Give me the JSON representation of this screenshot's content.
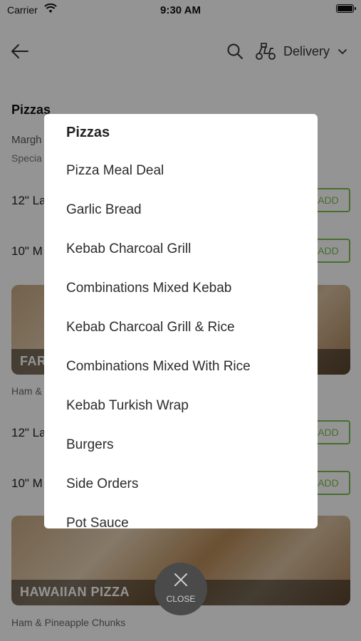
{
  "status_bar": {
    "carrier": "Carrier",
    "time": "9:30 AM"
  },
  "header": {
    "delivery_label": "Delivery"
  },
  "background": {
    "section_title": "Pizzas",
    "item_name": "Margh",
    "item_desc": "Specia",
    "size_rows": [
      "12\" La",
      "10\" M",
      "12\" La",
      "10\" M"
    ],
    "add_label": "ADD",
    "card1_title": "FAR",
    "card1_sub": "Ham &",
    "card2_title": "HAWAIIAN PIZZA",
    "card2_sub": "Ham & Pineapple Chunks"
  },
  "modal": {
    "title": "Pizzas",
    "items": [
      "Pizza Meal Deal",
      "Garlic Bread",
      "Kebab Charcoal Grill",
      "Combinations Mixed Kebab",
      "Kebab Charcoal Grill & Rice",
      "Combinations Mixed With Rice",
      "Kebab Turkish Wrap",
      "Burgers",
      "Side Orders",
      "Pot Sauce"
    ]
  },
  "close_button": {
    "label": "CLOSE"
  },
  "colors": {
    "accent_green": "#7bbf4c",
    "overlay": "rgba(0,0,0,0.42)"
  }
}
